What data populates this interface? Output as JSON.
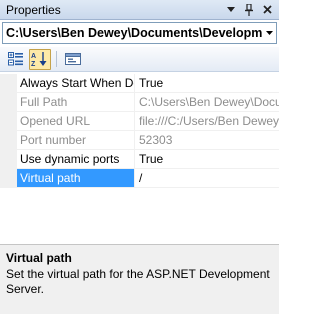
{
  "window": {
    "title": "Properties",
    "menu_icon": "dropdown-triangle-icon",
    "pin_icon": "pin-icon",
    "close_icon": "close-icon"
  },
  "object_selector": {
    "value": "C:\\Users\\Ben Dewey\\Documents\\Development"
  },
  "toolbar": {
    "buttons": [
      {
        "name": "categorized-icon",
        "active": false
      },
      {
        "name": "alphabetical-icon",
        "active": true
      },
      {
        "name": "property-pages-icon",
        "active": false
      }
    ]
  },
  "properties": [
    {
      "name": "Always Start When Debugging",
      "value": "True",
      "readonly": false,
      "selected": false
    },
    {
      "name": "Full Path",
      "value": "C:\\Users\\Ben Dewey\\Documents",
      "readonly": true,
      "selected": false
    },
    {
      "name": "Opened URL",
      "value": "file:///C:/Users/Ben Dewey/Do",
      "readonly": true,
      "selected": false
    },
    {
      "name": "Port number",
      "value": "52303",
      "readonly": true,
      "selected": false
    },
    {
      "name": "Use dynamic ports",
      "value": "True",
      "readonly": false,
      "selected": false
    },
    {
      "name": "Virtual path",
      "value": "/",
      "readonly": false,
      "selected": true
    }
  ],
  "description": {
    "title": "Virtual path",
    "text": "Set the virtual path for the ASP.NET Development Server."
  },
  "colors": {
    "selection": "#3399ff",
    "readonly_text": "#8d8d8d",
    "titlebar": "#c9d8ec"
  }
}
